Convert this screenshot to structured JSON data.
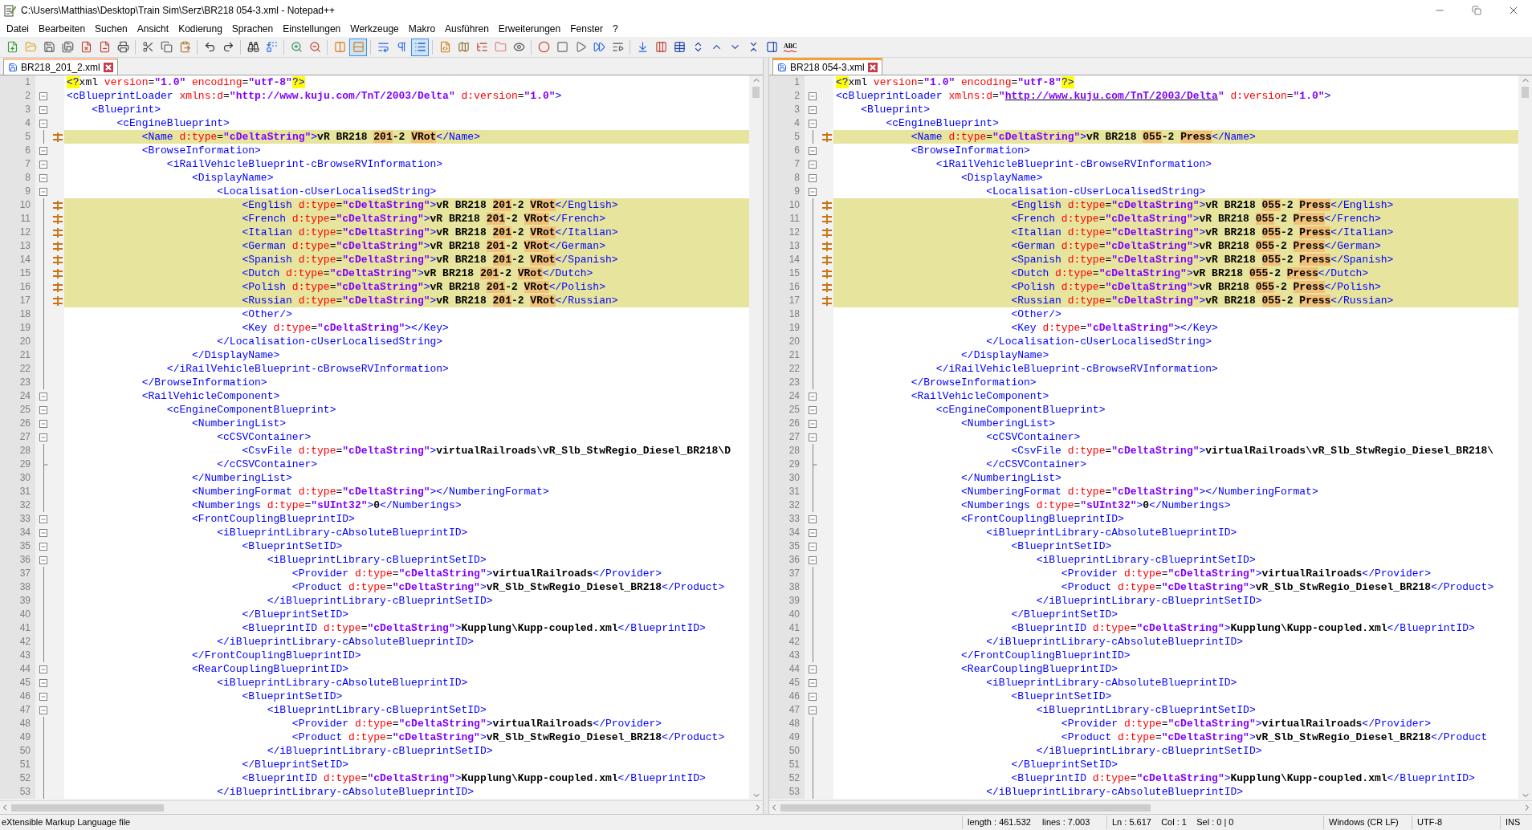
{
  "window": {
    "title": "C:\\Users\\Matthias\\Desktop\\Train Sim\\Serz\\BR218 054-3.xml - Notepad++"
  },
  "menu": [
    "Datei",
    "Bearbeiten",
    "Suchen",
    "Ansicht",
    "Kodierung",
    "Sprachen",
    "Einstellungen",
    "Werkzeuge",
    "Makro",
    "Ausführen",
    "Erweiterungen",
    "Fenster",
    "?"
  ],
  "toolbar": [
    {
      "pressed": false
    },
    {
      "pressed": false
    },
    {
      "pressed": false
    },
    {
      "pressed": false
    },
    {
      "pressed": false
    },
    {
      "pressed": false
    },
    {
      "pressed": false
    },
    {
      "pressed": false
    },
    {
      "pressed": false
    },
    {
      "pressed": false
    },
    {
      "pressed": false
    },
    {
      "pressed": false
    },
    {
      "pressed": false
    },
    {
      "pressed": false
    },
    {
      "pressed": false
    },
    {
      "pressed": false
    },
    {
      "pressed": false
    },
    {
      "pressed": true
    },
    {
      "pressed": false
    },
    {
      "pressed": false
    },
    {
      "pressed": true
    },
    {
      "pressed": false
    },
    {
      "pressed": false
    },
    {
      "pressed": false
    },
    {
      "pressed": false
    },
    {
      "pressed": false
    },
    {
      "pressed": false
    },
    {
      "pressed": false
    },
    {
      "pressed": false
    },
    {
      "pressed": false
    },
    {
      "pressed": false
    },
    {
      "pressed": false
    },
    {
      "pressed": false
    },
    {
      "pressed": false
    },
    {
      "pressed": false
    },
    {
      "pressed": false
    },
    {
      "pressed": false
    },
    {
      "pressed": false
    },
    {
      "pressed": false
    }
  ],
  "spellcheck_label": "ABC",
  "panes": [
    {
      "active": false,
      "tab": {
        "label": "BR218_201_2.xml",
        "selected": true
      },
      "lines": [
        {
          "no": "1",
          "kind": "plain",
          "changed": false,
          "text": "<?xml version=\"1.0\" encoding=\"utf-8\"?>"
        },
        {
          "no": "2",
          "kind": "fold",
          "changed": false,
          "text": "<cBlueprintLoader xmlns:d=\"http://www.kuju.com/TnT/2003/Delta\" d:version=\"1.0\">"
        },
        {
          "no": "3",
          "kind": "fold",
          "changed": false,
          "text": "    <Blueprint>"
        },
        {
          "no": "4",
          "kind": "fold",
          "changed": false,
          "text": "        <cEngineBlueprint>"
        },
        {
          "no": "5",
          "kind": "body",
          "changed": true,
          "parts": [
            {
              "text": "            <Name d:type=\"cDeltaString\">vR BR218 ",
              "diff": false
            },
            {
              "text": "201",
              "diff": true
            },
            {
              "text": "-2 ",
              "diff": false
            },
            {
              "text": "VRot",
              "diff": true
            },
            {
              "text": "</Name>",
              "diff": false
            }
          ]
        },
        {
          "no": "6",
          "kind": "fold",
          "changed": false,
          "text": "            <BrowseInformation>"
        },
        {
          "no": "7",
          "kind": "fold",
          "changed": false,
          "text": "                <iRailVehicleBlueprint-cBrowseRVInformation>"
        },
        {
          "no": "8",
          "kind": "fold",
          "changed": false,
          "text": "                    <DisplayName>"
        },
        {
          "no": "9",
          "kind": "fold",
          "changed": false,
          "text": "                        <Localisation-cUserLocalisedString>"
        },
        {
          "no": "10",
          "kind": "body",
          "changed": true,
          "parts": [
            {
              "text": "                            <English d:type=\"cDeltaString\">vR BR218 ",
              "diff": false
            },
            {
              "text": "201",
              "diff": true
            },
            {
              "text": "-2 ",
              "diff": false
            },
            {
              "text": "VRot",
              "diff": true
            },
            {
              "text": "</English>",
              "diff": false
            }
          ]
        },
        {
          "no": "11",
          "kind": "body",
          "changed": true,
          "parts": [
            {
              "text": "                            <French d:type=\"cDeltaString\">vR BR218 ",
              "diff": false
            },
            {
              "text": "201",
              "diff": true
            },
            {
              "text": "-2 ",
              "diff": false
            },
            {
              "text": "VRot",
              "diff": true
            },
            {
              "text": "</French>",
              "diff": false
            }
          ]
        },
        {
          "no": "12",
          "kind": "body",
          "changed": true,
          "parts": [
            {
              "text": "                            <Italian d:type=\"cDeltaString\">vR BR218 ",
              "diff": false
            },
            {
              "text": "201",
              "diff": true
            },
            {
              "text": "-2 ",
              "diff": false
            },
            {
              "text": "VRot",
              "diff": true
            },
            {
              "text": "</Italian>",
              "diff": false
            }
          ]
        },
        {
          "no": "13",
          "kind": "body",
          "changed": true,
          "parts": [
            {
              "text": "                            <German d:type=\"cDeltaString\">vR BR218 ",
              "diff": false
            },
            {
              "text": "201",
              "diff": true
            },
            {
              "text": "-2 ",
              "diff": false
            },
            {
              "text": "VRot",
              "diff": true
            },
            {
              "text": "</German>",
              "diff": false
            }
          ]
        },
        {
          "no": "14",
          "kind": "body",
          "changed": true,
          "parts": [
            {
              "text": "                            <Spanish d:type=\"cDeltaString\">vR BR218 ",
              "diff": false
            },
            {
              "text": "201",
              "diff": true
            },
            {
              "text": "-2 ",
              "diff": false
            },
            {
              "text": "VRot",
              "diff": true
            },
            {
              "text": "</Spanish>",
              "diff": false
            }
          ]
        },
        {
          "no": "15",
          "kind": "body",
          "changed": true,
          "parts": [
            {
              "text": "                            <Dutch d:type=\"cDeltaString\">vR BR218 ",
              "diff": false
            },
            {
              "text": "201",
              "diff": true
            },
            {
              "text": "-2 ",
              "diff": false
            },
            {
              "text": "VRot",
              "diff": true
            },
            {
              "text": "</Dutch>",
              "diff": false
            }
          ]
        },
        {
          "no": "16",
          "kind": "body",
          "changed": true,
          "parts": [
            {
              "text": "                            <Polish d:type=\"cDeltaString\">vR BR218 ",
              "diff": false
            },
            {
              "text": "201",
              "diff": true
            },
            {
              "text": "-2 ",
              "diff": false
            },
            {
              "text": "VRot",
              "diff": true
            },
            {
              "text": "</Polish>",
              "diff": false
            }
          ]
        },
        {
          "no": "17",
          "kind": "body",
          "changed": true,
          "parts": [
            {
              "text": "                            <Russian d:type=\"cDeltaString\">vR BR218 ",
              "diff": false
            },
            {
              "text": "201",
              "diff": true
            },
            {
              "text": "-2 ",
              "diff": false
            },
            {
              "text": "VRot",
              "diff": true
            },
            {
              "text": "</Russian>",
              "diff": false
            }
          ]
        },
        {
          "no": "18",
          "kind": "body",
          "changed": false,
          "text": "                            <Other/>"
        },
        {
          "no": "19",
          "kind": "body",
          "changed": false,
          "text": "                            <Key d:type=\"cDeltaString\"></Key>"
        },
        {
          "no": "20",
          "kind": "body",
          "changed": false,
          "text": "                        </Localisation-cUserLocalisedString>"
        },
        {
          "no": "21",
          "kind": "body",
          "changed": false,
          "text": "                    </DisplayName>"
        },
        {
          "no": "22",
          "kind": "body",
          "changed": false,
          "text": "                </iRailVehicleBlueprint-cBrowseRVInformation>"
        },
        {
          "no": "23",
          "kind": "body",
          "changed": false,
          "text": "            </BrowseInformation>"
        },
        {
          "no": "24",
          "kind": "fold",
          "changed": false,
          "text": "            <RailVehicleComponent>"
        },
        {
          "no": "25",
          "kind": "fold",
          "changed": false,
          "text": "                <cEngineComponentBlueprint>"
        },
        {
          "no": "26",
          "kind": "fold",
          "changed": false,
          "text": "                    <NumberingList>"
        },
        {
          "no": "27",
          "kind": "fold",
          "changed": false,
          "text": "                        <cCSVContainer>"
        },
        {
          "no": "28",
          "kind": "body",
          "changed": false,
          "text": "                            <CsvFile d:type=\"cDeltaString\">virtualRailroads\\vR_Slb_StwRegio_Diesel_BR218\\D"
        },
        {
          "no": "29",
          "kind": "end",
          "changed": false,
          "text": "                        </cCSVContainer>"
        },
        {
          "no": "30",
          "kind": "body",
          "changed": false,
          "text": "                    </NumberingList>"
        },
        {
          "no": "31",
          "kind": "body",
          "changed": false,
          "text": "                    <NumberingFormat d:type=\"cDeltaString\"></NumberingFormat>"
        },
        {
          "no": "32",
          "kind": "body",
          "changed": false,
          "text": "                    <Numberings d:type=\"sUInt32\">0</Numberings>"
        },
        {
          "no": "33",
          "kind": "fold",
          "changed": false,
          "text": "                    <FrontCouplingBlueprintID>"
        },
        {
          "no": "34",
          "kind": "fold",
          "changed": false,
          "text": "                        <iBlueprintLibrary-cAbsoluteBlueprintID>"
        },
        {
          "no": "35",
          "kind": "fold",
          "changed": false,
          "text": "                            <BlueprintSetID>"
        },
        {
          "no": "36",
          "kind": "fold",
          "changed": false,
          "text": "                                <iBlueprintLibrary-cBlueprintSetID>"
        },
        {
          "no": "37",
          "kind": "body",
          "changed": false,
          "text": "                                    <Provider d:type=\"cDeltaString\">virtualRailroads</Provider>"
        },
        {
          "no": "38",
          "kind": "body",
          "changed": false,
          "text": "                                    <Product d:type=\"cDeltaString\">vR_Slb_StwRegio_Diesel_BR218</Product>"
        },
        {
          "no": "39",
          "kind": "body",
          "changed": false,
          "text": "                                </iBlueprintLibrary-cBlueprintSetID>"
        },
        {
          "no": "40",
          "kind": "body",
          "changed": false,
          "text": "                            </BlueprintSetID>"
        },
        {
          "no": "41",
          "kind": "body",
          "changed": false,
          "text": "                            <BlueprintID d:type=\"cDeltaString\">Kupplung\\Kupp-coupled.xml</BlueprintID>"
        },
        {
          "no": "42",
          "kind": "body",
          "changed": false,
          "text": "                        </iBlueprintLibrary-cAbsoluteBlueprintID>"
        },
        {
          "no": "43",
          "kind": "body",
          "changed": false,
          "text": "                    </FrontCouplingBlueprintID>"
        },
        {
          "no": "44",
          "kind": "fold",
          "changed": false,
          "text": "                    <RearCouplingBlueprintID>"
        },
        {
          "no": "45",
          "kind": "fold",
          "changed": false,
          "text": "                        <iBlueprintLibrary-cAbsoluteBlueprintID>"
        },
        {
          "no": "46",
          "kind": "fold",
          "changed": false,
          "text": "                            <BlueprintSetID>"
        },
        {
          "no": "47",
          "kind": "fold",
          "changed": false,
          "text": "                                <iBlueprintLibrary-cBlueprintSetID>"
        },
        {
          "no": "48",
          "kind": "body",
          "changed": false,
          "text": "                                    <Provider d:type=\"cDeltaString\">virtualRailroads</Provider>"
        },
        {
          "no": "49",
          "kind": "body",
          "changed": false,
          "text": "                                    <Product d:type=\"cDeltaString\">vR_Slb_StwRegio_Diesel_BR218</Product>"
        },
        {
          "no": "50",
          "kind": "body",
          "changed": false,
          "text": "                                </iBlueprintLibrary-cBlueprintSetID>"
        },
        {
          "no": "51",
          "kind": "body",
          "changed": false,
          "text": "                            </BlueprintSetID>"
        },
        {
          "no": "52",
          "kind": "body",
          "changed": false,
          "text": "                            <BlueprintID d:type=\"cDeltaString\">Kupplung\\Kupp-coupled.xml</BlueprintID>"
        },
        {
          "no": "53",
          "kind": "body",
          "changed": false,
          "text": "                        </iBlueprintLibrary-cAbsoluteBlueprintID>"
        }
      ]
    },
    {
      "active": true,
      "tab": {
        "label": "BR218 054-3.xml",
        "selected": true
      },
      "lines": [
        {
          "no": "1",
          "kind": "plain",
          "changed": false,
          "text": "<?xml version=\"1.0\" encoding=\"utf-8\"?>"
        },
        {
          "no": "2",
          "kind": "fold",
          "changed": false,
          "parts": [
            {
              "text": "<cBlueprintLoader xmlns:d=\"",
              "link": false
            },
            {
              "text": "http://www.kuju.com/TnT/2003/Delta",
              "link": true
            },
            {
              "text": "\" d:version=\"1.0\">",
              "link": false
            }
          ]
        },
        {
          "no": "3",
          "kind": "fold",
          "changed": false,
          "text": "    <Blueprint>"
        },
        {
          "no": "4",
          "kind": "fold",
          "changed": false,
          "text": "        <cEngineBlueprint>"
        },
        {
          "no": "5",
          "kind": "body",
          "changed": true,
          "parts": [
            {
              "text": "            <Name d:type=\"cDeltaString\">vR BR218 ",
              "diff": false
            },
            {
              "text": "055",
              "diff": true
            },
            {
              "text": "-2 ",
              "diff": false
            },
            {
              "text": "Press",
              "diff": true
            },
            {
              "text": "</Name>",
              "diff": false
            }
          ]
        },
        {
          "no": "6",
          "kind": "fold",
          "changed": false,
          "text": "            <BrowseInformation>"
        },
        {
          "no": "7",
          "kind": "fold",
          "changed": false,
          "text": "                <iRailVehicleBlueprint-cBrowseRVInformation>"
        },
        {
          "no": "8",
          "kind": "fold",
          "changed": false,
          "text": "                    <DisplayName>"
        },
        {
          "no": "9",
          "kind": "fold",
          "changed": false,
          "text": "                        <Localisation-cUserLocalisedString>"
        },
        {
          "no": "10",
          "kind": "body",
          "changed": true,
          "parts": [
            {
              "text": "                            <English d:type=\"cDeltaString\">vR BR218 ",
              "diff": false
            },
            {
              "text": "055",
              "diff": true
            },
            {
              "text": "-2 ",
              "diff": false
            },
            {
              "text": "Press",
              "diff": true
            },
            {
              "text": "</English>",
              "diff": false
            }
          ]
        },
        {
          "no": "11",
          "kind": "body",
          "changed": true,
          "parts": [
            {
              "text": "                            <French d:type=\"cDeltaString\">vR BR218 ",
              "diff": false
            },
            {
              "text": "055",
              "diff": true
            },
            {
              "text": "-2 ",
              "diff": false
            },
            {
              "text": "Press",
              "diff": true
            },
            {
              "text": "</French>",
              "diff": false
            }
          ]
        },
        {
          "no": "12",
          "kind": "body",
          "changed": true,
          "parts": [
            {
              "text": "                            <Italian d:type=\"cDeltaString\">vR BR218 ",
              "diff": false
            },
            {
              "text": "055",
              "diff": true
            },
            {
              "text": "-2 ",
              "diff": false
            },
            {
              "text": "Press",
              "diff": true
            },
            {
              "text": "</Italian>",
              "diff": false
            }
          ]
        },
        {
          "no": "13",
          "kind": "body",
          "changed": true,
          "parts": [
            {
              "text": "                            <German d:type=\"cDeltaString\">vR BR218 ",
              "diff": false
            },
            {
              "text": "055",
              "diff": true
            },
            {
              "text": "-2 ",
              "diff": false
            },
            {
              "text": "Press",
              "diff": true
            },
            {
              "text": "</German>",
              "diff": false
            }
          ]
        },
        {
          "no": "14",
          "kind": "body",
          "changed": true,
          "parts": [
            {
              "text": "                            <Spanish d:type=\"cDeltaString\">vR BR218 ",
              "diff": false
            },
            {
              "text": "055",
              "diff": true
            },
            {
              "text": "-2 ",
              "diff": false
            },
            {
              "text": "Press",
              "diff": true
            },
            {
              "text": "</Spanish>",
              "diff": false
            }
          ]
        },
        {
          "no": "15",
          "kind": "body",
          "changed": true,
          "parts": [
            {
              "text": "                            <Dutch d:type=\"cDeltaString\">vR BR218 ",
              "diff": false
            },
            {
              "text": "055",
              "diff": true
            },
            {
              "text": "-2 ",
              "diff": false
            },
            {
              "text": "Press",
              "diff": true
            },
            {
              "text": "</Dutch>",
              "diff": false
            }
          ]
        },
        {
          "no": "16",
          "kind": "body",
          "changed": true,
          "parts": [
            {
              "text": "                            <Polish d:type=\"cDeltaString\">vR BR218 ",
              "diff": false
            },
            {
              "text": "055",
              "diff": true
            },
            {
              "text": "-2 ",
              "diff": false
            },
            {
              "text": "Press",
              "diff": true
            },
            {
              "text": "</Polish>",
              "diff": false
            }
          ]
        },
        {
          "no": "17",
          "kind": "body",
          "changed": true,
          "parts": [
            {
              "text": "                            <Russian d:type=\"cDeltaString\">vR BR218 ",
              "diff": false
            },
            {
              "text": "055",
              "diff": true
            },
            {
              "text": "-2 ",
              "diff": false
            },
            {
              "text": "Press",
              "diff": true
            },
            {
              "text": "</Russian>",
              "diff": false
            }
          ]
        },
        {
          "no": "18",
          "kind": "body",
          "changed": false,
          "text": "                            <Other/>"
        },
        {
          "no": "19",
          "kind": "body",
          "changed": false,
          "text": "                            <Key d:type=\"cDeltaString\"></Key>"
        },
        {
          "no": "20",
          "kind": "body",
          "changed": false,
          "text": "                        </Localisation-cUserLocalisedString>"
        },
        {
          "no": "21",
          "kind": "body",
          "changed": false,
          "text": "                    </DisplayName>"
        },
        {
          "no": "22",
          "kind": "body",
          "changed": false,
          "text": "                </iRailVehicleBlueprint-cBrowseRVInformation>"
        },
        {
          "no": "23",
          "kind": "body",
          "changed": false,
          "text": "            </BrowseInformation>"
        },
        {
          "no": "24",
          "kind": "fold",
          "changed": false,
          "text": "            <RailVehicleComponent>"
        },
        {
          "no": "25",
          "kind": "fold",
          "changed": false,
          "text": "                <cEngineComponentBlueprint>"
        },
        {
          "no": "26",
          "kind": "fold",
          "changed": false,
          "text": "                    <NumberingList>"
        },
        {
          "no": "27",
          "kind": "fold",
          "changed": false,
          "text": "                        <cCSVContainer>"
        },
        {
          "no": "28",
          "kind": "body",
          "changed": false,
          "text": "                            <CsvFile d:type=\"cDeltaString\">virtualRailroads\\vR_Slb_StwRegio_Diesel_BR218\\"
        },
        {
          "no": "29",
          "kind": "end",
          "changed": false,
          "text": "                        </cCSVContainer>"
        },
        {
          "no": "30",
          "kind": "body",
          "changed": false,
          "text": "                    </NumberingList>"
        },
        {
          "no": "31",
          "kind": "body",
          "changed": false,
          "text": "                    <NumberingFormat d:type=\"cDeltaString\"></NumberingFormat>"
        },
        {
          "no": "32",
          "kind": "body",
          "changed": false,
          "text": "                    <Numberings d:type=\"sUInt32\">0</Numberings>"
        },
        {
          "no": "33",
          "kind": "fold",
          "changed": false,
          "text": "                    <FrontCouplingBlueprintID>"
        },
        {
          "no": "34",
          "kind": "fold",
          "changed": false,
          "text": "                        <iBlueprintLibrary-cAbsoluteBlueprintID>"
        },
        {
          "no": "35",
          "kind": "fold",
          "changed": false,
          "text": "                            <BlueprintSetID>"
        },
        {
          "no": "36",
          "kind": "fold",
          "changed": false,
          "text": "                                <iBlueprintLibrary-cBlueprintSetID>"
        },
        {
          "no": "37",
          "kind": "body",
          "changed": false,
          "text": "                                    <Provider d:type=\"cDeltaString\">virtualRailroads</Provider>"
        },
        {
          "no": "38",
          "kind": "body",
          "changed": false,
          "text": "                                    <Product d:type=\"cDeltaString\">vR_Slb_StwRegio_Diesel_BR218</Product>"
        },
        {
          "no": "39",
          "kind": "body",
          "changed": false,
          "text": "                                </iBlueprintLibrary-cBlueprintSetID>"
        },
        {
          "no": "40",
          "kind": "body",
          "changed": false,
          "text": "                            </BlueprintSetID>"
        },
        {
          "no": "41",
          "kind": "body",
          "changed": false,
          "text": "                            <BlueprintID d:type=\"cDeltaString\">Kupplung\\Kupp-coupled.xml</BlueprintID>"
        },
        {
          "no": "42",
          "kind": "body",
          "changed": false,
          "text": "                        </iBlueprintLibrary-cAbsoluteBlueprintID>"
        },
        {
          "no": "43",
          "kind": "body",
          "changed": false,
          "text": "                    </FrontCouplingBlueprintID>"
        },
        {
          "no": "44",
          "kind": "fold",
          "changed": false,
          "text": "                    <RearCouplingBlueprintID>"
        },
        {
          "no": "45",
          "kind": "fold",
          "changed": false,
          "text": "                        <iBlueprintLibrary-cAbsoluteBlueprintID>"
        },
        {
          "no": "46",
          "kind": "fold",
          "changed": false,
          "text": "                            <BlueprintSetID>"
        },
        {
          "no": "47",
          "kind": "fold",
          "changed": false,
          "text": "                                <iBlueprintLibrary-cBlueprintSetID>"
        },
        {
          "no": "48",
          "kind": "body",
          "changed": false,
          "text": "                                    <Provider d:type=\"cDeltaString\">virtualRailroads</Provider>"
        },
        {
          "no": "49",
          "kind": "body",
          "changed": false,
          "text": "                                    <Product d:type=\"cDeltaString\">vR_Slb_StwRegio_Diesel_BR218</Product"
        },
        {
          "no": "50",
          "kind": "body",
          "changed": false,
          "text": "                                </iBlueprintLibrary-cBlueprintSetID>"
        },
        {
          "no": "51",
          "kind": "body",
          "changed": false,
          "text": "                            </BlueprintSetID>"
        },
        {
          "no": "52",
          "kind": "body",
          "changed": false,
          "text": "                            <BlueprintID d:type=\"cDeltaString\">Kupplung\\Kupp-coupled.xml</BlueprintID>"
        },
        {
          "no": "53",
          "kind": "body",
          "changed": false,
          "text": "                        </iBlueprintLibrary-cAbsoluteBlueprintID>"
        }
      ]
    }
  ],
  "status_bar": {
    "file_type": "eXtensible Markup Language file",
    "length": "length : 461.532",
    "lines": "lines : 7.003",
    "position": "Ln : 5.617    Col : 1    Sel : 0 | 0",
    "eol": "Windows (CR LF)",
    "encoding": "UTF-8",
    "mode": "INS"
  }
}
